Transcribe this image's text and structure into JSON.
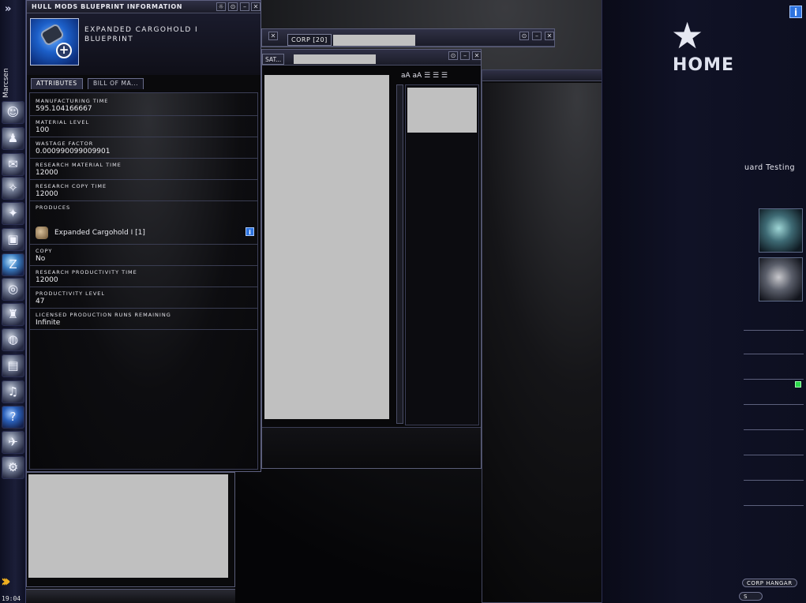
{
  "neocom": {
    "pilot_name": "Marcsen",
    "clock": "19:04",
    "expand_glyph": "»",
    "icons": [
      "character-icon",
      "people-icon",
      "mail-icon",
      "map-icon",
      "wallet-icon",
      "assets-icon",
      "science-icon",
      "jukebox-icon",
      "fitting-icon",
      "market-icon",
      "journal-icon",
      "help-icon",
      "corp-icon",
      "ships-icon",
      "industry-icon"
    ]
  },
  "blueprint_window": {
    "title": "Hull Mods Blueprint Information",
    "item_name": "Expanded Cargohold I Blueprint",
    "tabs": [
      {
        "label": "Attributes",
        "active": true
      },
      {
        "label": "Bill of Ma...",
        "active": false
      }
    ],
    "attributes": [
      {
        "label": "Manufacturing Time",
        "value": "595.104166667"
      },
      {
        "label": "Material Level",
        "value": "100"
      },
      {
        "label": "Wastage Factor",
        "value": "0.000990099009901"
      },
      {
        "label": "Research Material Time",
        "value": "12000"
      },
      {
        "label": "Research Copy Time",
        "value": "12000"
      }
    ],
    "produces_label": "Produces",
    "produces_item": "Expanded Cargohold I [1]",
    "attributes_after": [
      {
        "label": "Copy",
        "value": "No"
      },
      {
        "label": "Research Productivity Time",
        "value": "12000"
      },
      {
        "label": "Productivity Level",
        "value": "47"
      },
      {
        "label": "Licensed Production Runs Remaining",
        "value": "Infinite"
      }
    ]
  },
  "chat_windows": {
    "corp_tab": "Corp [20]",
    "sat_tab": "Sat..."
  },
  "station_panel": {
    "home_text": "HOME",
    "guard_text": "uard Testing",
    "corp_hangar": "Corp Hangar",
    "small_label": "s"
  }
}
